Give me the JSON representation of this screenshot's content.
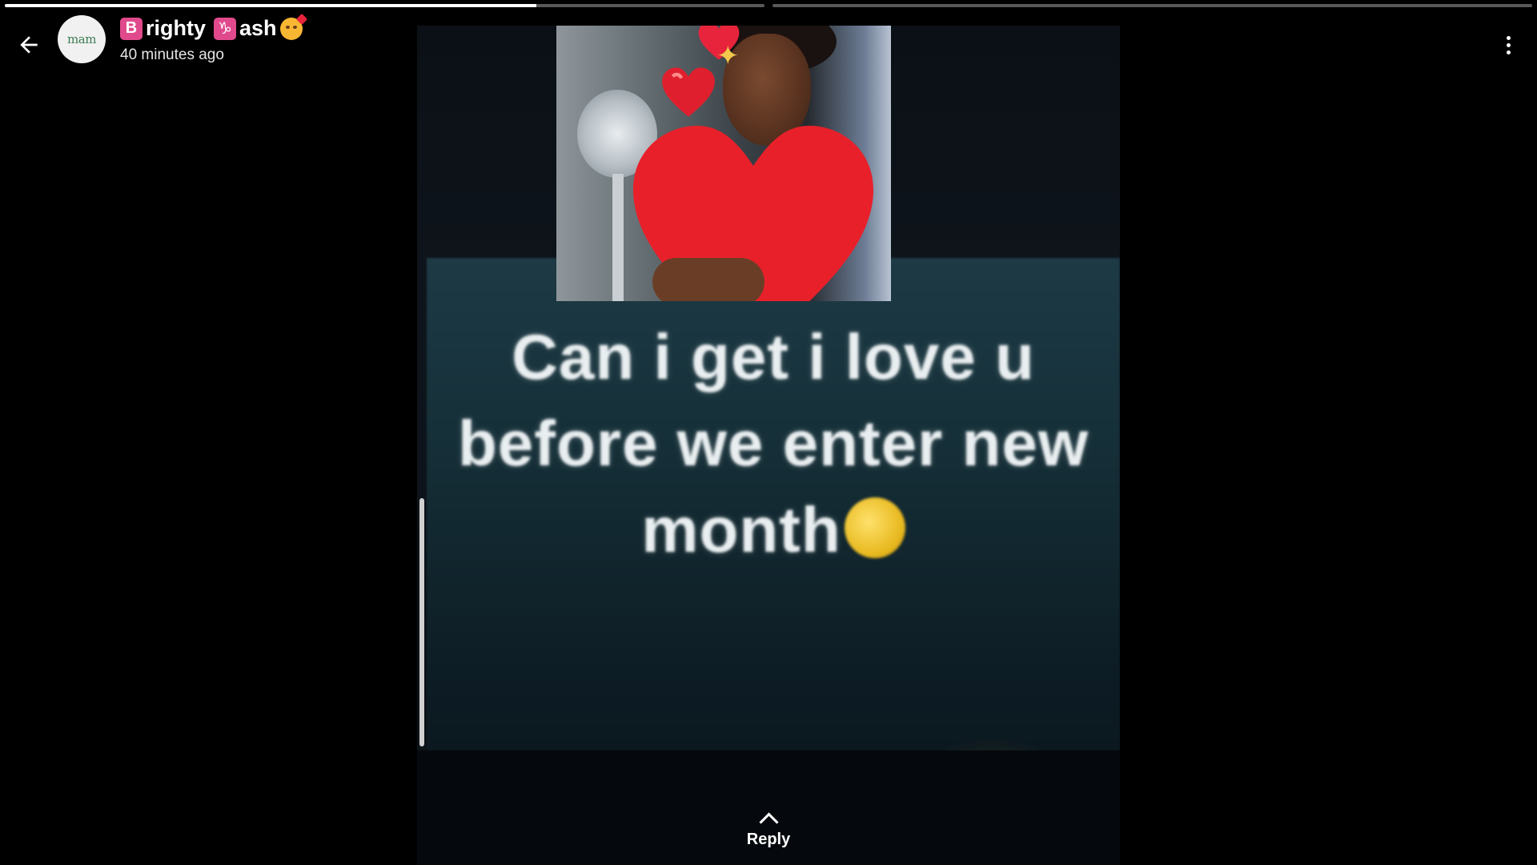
{
  "header": {
    "avatar_text": "mam",
    "name_badge_1": "B",
    "name_part_1": "righty",
    "name_badge_2": "♑",
    "name_part_2": "ash",
    "timestamp": "40 minutes ago"
  },
  "progress": {
    "segments": [
      {
        "progress": 0.7
      },
      {
        "progress": 0
      }
    ]
  },
  "status": {
    "text_lines": [
      "Can i get i love u",
      "before we enter new",
      "month"
    ]
  },
  "reply": {
    "label": "Reply"
  },
  "colors": {
    "background": "#000000",
    "badge": "#e04a8c",
    "status_band": "#1d3a45",
    "heart": "#e8243c"
  }
}
